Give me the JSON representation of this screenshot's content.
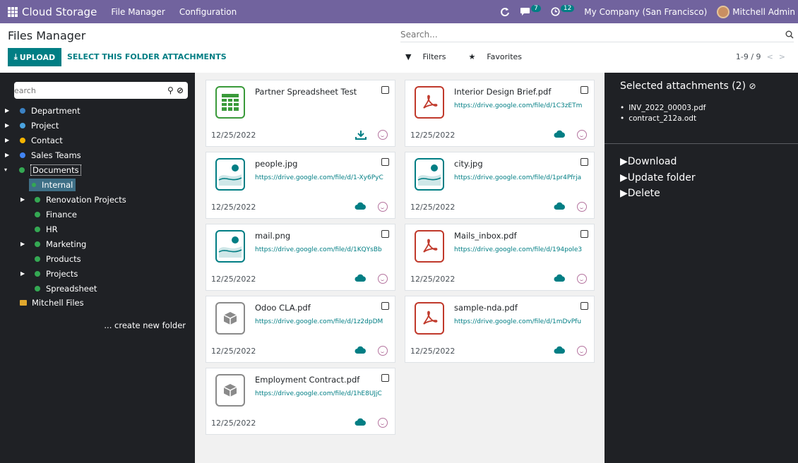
{
  "navbar": {
    "brand": "Cloud Storage",
    "menu": [
      "File Manager",
      "Configuration"
    ],
    "chat_count": "7",
    "activity_count": "12",
    "company": "My Company (San Francisco)",
    "user": "Mitchell Admin"
  },
  "control_panel": {
    "title": "Files Manager",
    "search_placeholder": "Search...",
    "upload_label": "UPLOAD",
    "select_label": "SELECT THIS FOLDER ATTACHMENTS",
    "filters_label": "Filters",
    "favorites_label": "Favorites",
    "pager": "1-9 / 9"
  },
  "sidebar": {
    "search_placeholder": "earch",
    "create_folder": "... create new folder",
    "tree": [
      {
        "label": "Department",
        "icon_color": "#3b82c4"
      },
      {
        "label": "Project",
        "icon_color": "#4aa3df"
      },
      {
        "label": "Contact",
        "icon_color": "#f4b400"
      },
      {
        "label": "Sales Teams",
        "icon_color": "#4285f4"
      },
      {
        "label": "Documents",
        "icon_color": "#34a853"
      },
      {
        "label": "Internal",
        "icon_color": "#34a853"
      },
      {
        "label": "Renovation Projects",
        "icon_color": "#34a853"
      },
      {
        "label": "Finance",
        "icon_color": "#34a853"
      },
      {
        "label": "HR",
        "icon_color": "#34a853"
      },
      {
        "label": "Marketing",
        "icon_color": "#34a853"
      },
      {
        "label": "Products",
        "icon_color": "#34a853"
      },
      {
        "label": "Projects",
        "icon_color": "#34a853"
      },
      {
        "label": "Spreadsheet",
        "icon_color": "#34a853"
      },
      {
        "label": "Mitchell Files",
        "icon_color": "#e0a82e"
      }
    ]
  },
  "files": [
    {
      "name": "Partner Spreadsheet Test",
      "url": "",
      "date": "12/25/2022",
      "type": "spreadsheet",
      "status_icon": "download-icon"
    },
    {
      "name": "Interior Design Brief.pdf",
      "url": "https://drive.google.com/file/d/1C3zETm",
      "date": "12/25/2022",
      "type": "pdf",
      "status_icon": "cloud-icon"
    },
    {
      "name": "people.jpg",
      "url": "https://drive.google.com/file/d/1-Xy6PyC",
      "date": "12/25/2022",
      "type": "image",
      "status_icon": "cloud-icon"
    },
    {
      "name": "city.jpg",
      "url": "https://drive.google.com/file/d/1pr4Pfrja",
      "date": "12/25/2022",
      "type": "image",
      "status_icon": "cloud-icon"
    },
    {
      "name": "mail.png",
      "url": "https://drive.google.com/file/d/1KQYsBb",
      "date": "12/25/2022",
      "type": "image",
      "status_icon": "cloud-icon"
    },
    {
      "name": "Mails_inbox.pdf",
      "url": "https://drive.google.com/file/d/194pole3",
      "date": "12/25/2022",
      "type": "pdf",
      "status_icon": "cloud-icon"
    },
    {
      "name": "Odoo CLA.pdf",
      "url": "https://drive.google.com/file/d/1z2dpDM",
      "date": "12/25/2022",
      "type": "box",
      "status_icon": "cloud-icon"
    },
    {
      "name": "sample-nda.pdf",
      "url": "https://drive.google.com/file/d/1mDvPfu",
      "date": "12/25/2022",
      "type": "pdf",
      "status_icon": "cloud-icon"
    },
    {
      "name": "Employment Contract.pdf",
      "url": "https://drive.google.com/file/d/1hE8UJjC",
      "date": "12/25/2022",
      "type": "box",
      "status_icon": "cloud-icon"
    }
  ],
  "right_panel": {
    "title": "Selected attachments (2)",
    "selected": [
      "INV_2022_00003.pdf",
      "contract_212a.odt"
    ],
    "actions": [
      "Download",
      "Update folder",
      "Delete"
    ]
  },
  "colors": {
    "navbar": "#71639e",
    "accent": "#017e84",
    "sidebar_bg": "#1f2125",
    "main_bg": "#f1f1f1"
  }
}
